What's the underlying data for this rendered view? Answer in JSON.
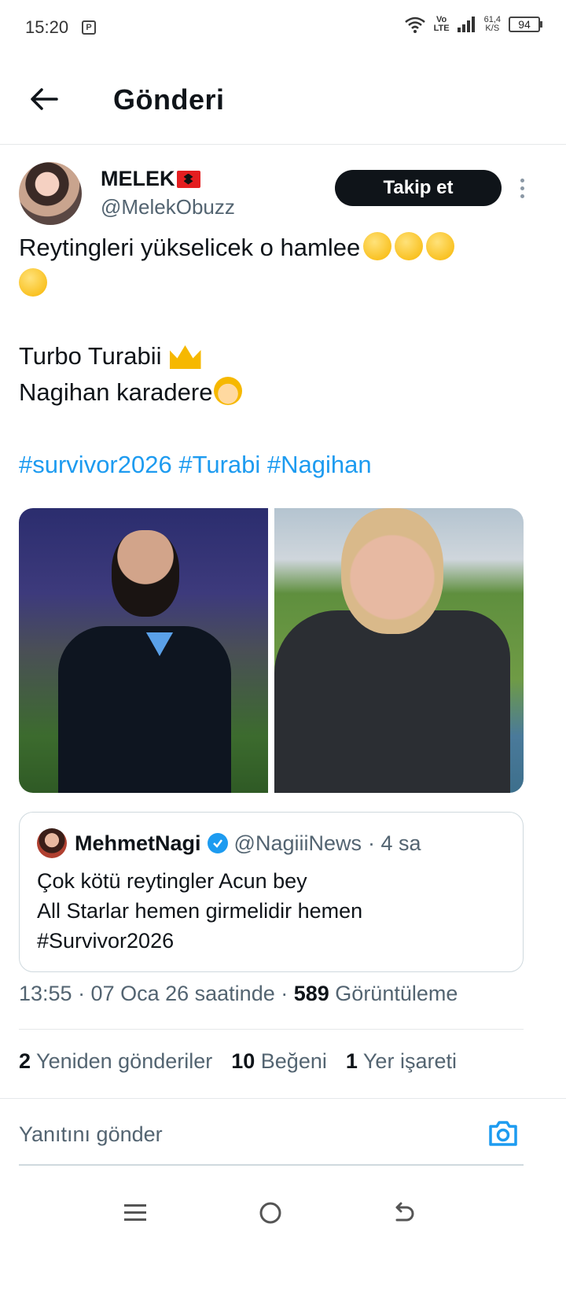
{
  "status_bar": {
    "time": "15:20",
    "app_icon_glyph": "P",
    "volte_top": "Vo",
    "volte_bottom": "LTE",
    "speed_value": "61,4",
    "speed_unit": "K/S",
    "battery": "94"
  },
  "header": {
    "title": "Gönderi"
  },
  "post": {
    "author_name": "MELEK",
    "author_handle": "@MelekObuzz",
    "follow_label": "Takip et",
    "text_line1": "Reytingleri yükselicek o hamlee",
    "text_line3": "Turbo Turabii",
    "text_line4": "Nagihan karadere",
    "hashtags": "#survivor2026 #Turabi #Nagihan"
  },
  "quote": {
    "name": "MehmetNagi",
    "handle": "@NagiiiNews",
    "time": "· 4 sa",
    "line1": "Çok kötü reytingler Acun bey",
    "line2": "All Starlar hemen girmelidir hemen",
    "line3": "#Survivor2026"
  },
  "meta": {
    "timestamp": "13:55 · 07 Oca 26 saatinde · ",
    "views_count": "589",
    "views_label": " Görüntüleme"
  },
  "stats": {
    "reposts_count": "2",
    "reposts_label": " Yeniden gönderiler",
    "likes_count": "10",
    "likes_label": " Beğeni",
    "bookmarks_count": "1",
    "bookmarks_label": " Yer işareti"
  },
  "reply": {
    "placeholder": "Yanıtını gönder"
  },
  "colors": {
    "accent": "#1d9bf0",
    "text": "#0f1419",
    "muted": "#536471"
  },
  "icons": [
    "back-arrow-icon",
    "more-vertical-icon",
    "verified-badge-icon",
    "camera-icon",
    "menu-icon",
    "home-circle-icon",
    "back-nav-icon"
  ]
}
